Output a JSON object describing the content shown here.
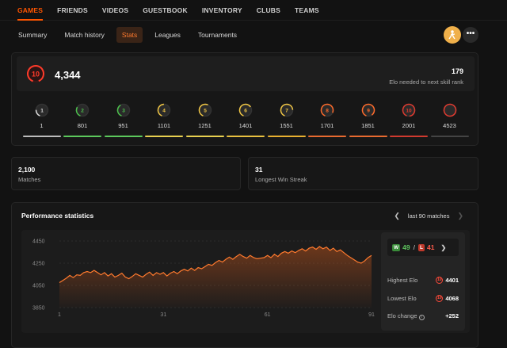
{
  "topnav": [
    "GAMES",
    "FRIENDS",
    "VIDEOS",
    "GUESTBOOK",
    "INVENTORY",
    "CLUBS",
    "TEAMS"
  ],
  "subnav": [
    "Summary",
    "Match history",
    "Stats",
    "Leagues",
    "Tournaments"
  ],
  "elo": {
    "level": "10",
    "value": "4,344",
    "needed": "179",
    "needed_label": "Elo needed to next skill rank"
  },
  "levels": [
    {
      "label": "1",
      "elo": "1",
      "color": "#dddddd"
    },
    {
      "label": "2",
      "elo": "801",
      "color": "#4cc24c"
    },
    {
      "label": "3",
      "elo": "951",
      "color": "#4cc24c"
    },
    {
      "label": "4",
      "elo": "1101",
      "color": "#f2c744"
    },
    {
      "label": "5",
      "elo": "1251",
      "color": "#f2c744"
    },
    {
      "label": "6",
      "elo": "1401",
      "color": "#f2c744"
    },
    {
      "label": "7",
      "elo": "1551",
      "color": "#f2c744"
    },
    {
      "label": "8",
      "elo": "1701",
      "color": "#ff6a2a"
    },
    {
      "label": "9",
      "elo": "1851",
      "color": "#ff6a2a"
    },
    {
      "label": "10",
      "elo": "2001",
      "color": "#e03a2f"
    },
    {
      "label": "",
      "elo": "4523",
      "color": "#e03a2f"
    }
  ],
  "level_bar_colors": [
    "#bbbbbb",
    "#5cc85c",
    "#5cc85c",
    "#e8d050",
    "#e8d050",
    "#e8c040",
    "#e8b030",
    "#e86a30",
    "#e86a30",
    "#d03a2f",
    "#444444"
  ],
  "stats": {
    "matches_value": "2,100",
    "matches_label": "Matches",
    "streak_value": "31",
    "streak_label": "Longest Win Streak"
  },
  "performance": {
    "title": "Performance statistics",
    "range": "last 90 matches",
    "wins": "49",
    "losses": "41",
    "w_badge": "W",
    "l_badge": "L",
    "slash": "/",
    "highest_label": "Highest Elo",
    "highest_value": "4401",
    "lowest_label": "Lowest Elo",
    "lowest_value": "4068",
    "change_label": "Elo change",
    "change_value": "+252"
  },
  "chart_data": {
    "type": "area",
    "ylim": [
      3850,
      4450
    ],
    "yticks": [
      "4450",
      "4250",
      "4050",
      "3850"
    ],
    "xticks": [
      "1",
      "31",
      "61",
      "91"
    ],
    "x": [
      1,
      2,
      3,
      4,
      5,
      6,
      7,
      8,
      9,
      10,
      11,
      12,
      13,
      14,
      15,
      16,
      17,
      18,
      19,
      20,
      21,
      22,
      23,
      24,
      25,
      26,
      27,
      28,
      29,
      30,
      31,
      32,
      33,
      34,
      35,
      36,
      37,
      38,
      39,
      40,
      41,
      42,
      43,
      44,
      45,
      46,
      47,
      48,
      49,
      50,
      51,
      52,
      53,
      54,
      55,
      56,
      57,
      58,
      59,
      60,
      61,
      62,
      63,
      64,
      65,
      66,
      67,
      68,
      69,
      70,
      71,
      72,
      73,
      74,
      75,
      76,
      77,
      78,
      79,
      80,
      81,
      82,
      83,
      84,
      85,
      86,
      87,
      88,
      89,
      90,
      91
    ],
    "values": [
      4075,
      4095,
      4115,
      4140,
      4120,
      4145,
      4140,
      4165,
      4175,
      4165,
      4185,
      4165,
      4145,
      4165,
      4135,
      4155,
      4125,
      4140,
      4160,
      4125,
      4110,
      4130,
      4155,
      4140,
      4125,
      4150,
      4170,
      4140,
      4165,
      4150,
      4165,
      4135,
      4160,
      4175,
      4155,
      4180,
      4195,
      4180,
      4205,
      4185,
      4210,
      4200,
      4220,
      4240,
      4230,
      4255,
      4275,
      4260,
      4285,
      4305,
      4285,
      4310,
      4330,
      4310,
      4295,
      4320,
      4300,
      4290,
      4295,
      4300,
      4320,
      4300,
      4330,
      4310,
      4340,
      4355,
      4340,
      4360,
      4345,
      4365,
      4380,
      4360,
      4385,
      4395,
      4375,
      4400,
      4380,
      4395,
      4365,
      4385,
      4355,
      4370,
      4345,
      4320,
      4300,
      4280,
      4260,
      4250,
      4270,
      4300,
      4320
    ]
  }
}
